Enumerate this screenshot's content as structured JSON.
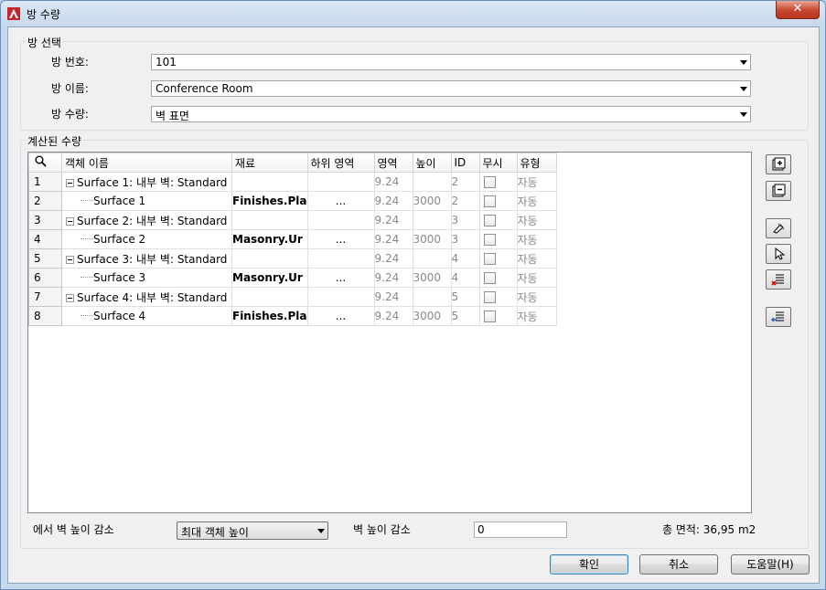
{
  "window": {
    "title": "방 수량",
    "close_symbol": "✕"
  },
  "room_selection": {
    "group_label": "방 선택",
    "room_number_label": "방 번호:",
    "room_number_value": "101",
    "room_name_label": "방 이름:",
    "room_name_value": "Conference Room",
    "room_quantity_label": "방 수량:",
    "room_quantity_value": "벽 표면"
  },
  "calculated": {
    "group_label": "계산된 수량",
    "columns": [
      "객체 이름",
      "재료",
      "하위 영역",
      "영역",
      "높이",
      "ID",
      "무시",
      "유형"
    ],
    "rows": [
      {
        "num": "1",
        "name": "Surface 1: 내부 벽: Standard",
        "level": 0,
        "material": "",
        "subarea": "",
        "area": "9.24",
        "height": "",
        "id": "2",
        "ignore": false,
        "type": "자동"
      },
      {
        "num": "2",
        "name": "Surface 1",
        "level": 1,
        "material": "Finishes.Pla",
        "subarea": "...",
        "area": "9.24",
        "height": "3000",
        "id": "2",
        "ignore": false,
        "type": "자동"
      },
      {
        "num": "3",
        "name": "Surface 2: 내부 벽: Standard",
        "level": 0,
        "material": "",
        "subarea": "",
        "area": "9.24",
        "height": "",
        "id": "3",
        "ignore": false,
        "type": "자동"
      },
      {
        "num": "4",
        "name": "Surface 2",
        "level": 1,
        "material": "Masonry.Ur",
        "subarea": "...",
        "area": "9.24",
        "height": "3000",
        "id": "3",
        "ignore": false,
        "type": "자동"
      },
      {
        "num": "5",
        "name": "Surface 3: 내부 벽: Standard",
        "level": 0,
        "material": "",
        "subarea": "",
        "area": "9.24",
        "height": "",
        "id": "4",
        "ignore": false,
        "type": "자동"
      },
      {
        "num": "6",
        "name": "Surface 3",
        "level": 1,
        "material": "Masonry.Ur",
        "subarea": "...",
        "area": "9.24",
        "height": "3000",
        "id": "4",
        "ignore": false,
        "type": "자동"
      },
      {
        "num": "7",
        "name": "Surface 4: 내부 벽: Standard",
        "level": 0,
        "material": "",
        "subarea": "",
        "area": "9.24",
        "height": "",
        "id": "5",
        "ignore": false,
        "type": "자동"
      },
      {
        "num": "8",
        "name": "Surface 4",
        "level": 1,
        "material": "Finishes.Pla",
        "subarea": "...",
        "area": "9.24",
        "height": "3000",
        "id": "5",
        "ignore": false,
        "type": "자동"
      }
    ]
  },
  "footer": {
    "reduce_label": "에서 벽 높이 감소",
    "reduce_select_value": "최대 객체 높이",
    "wall_reduce_label": "벽 높이 감소",
    "wall_reduce_value": "0",
    "total_area": "총 면적: 36,95 m2"
  },
  "buttons": {
    "ok": "확인",
    "cancel": "취소",
    "help": "도움말(H)"
  },
  "icons": {
    "search": "search-icon",
    "add": "add-row-icon",
    "remove": "remove-row-icon",
    "pick": "pick-object-icon",
    "select": "select-object-icon",
    "delete": "delete-list-icon",
    "import": "import-list-icon"
  }
}
